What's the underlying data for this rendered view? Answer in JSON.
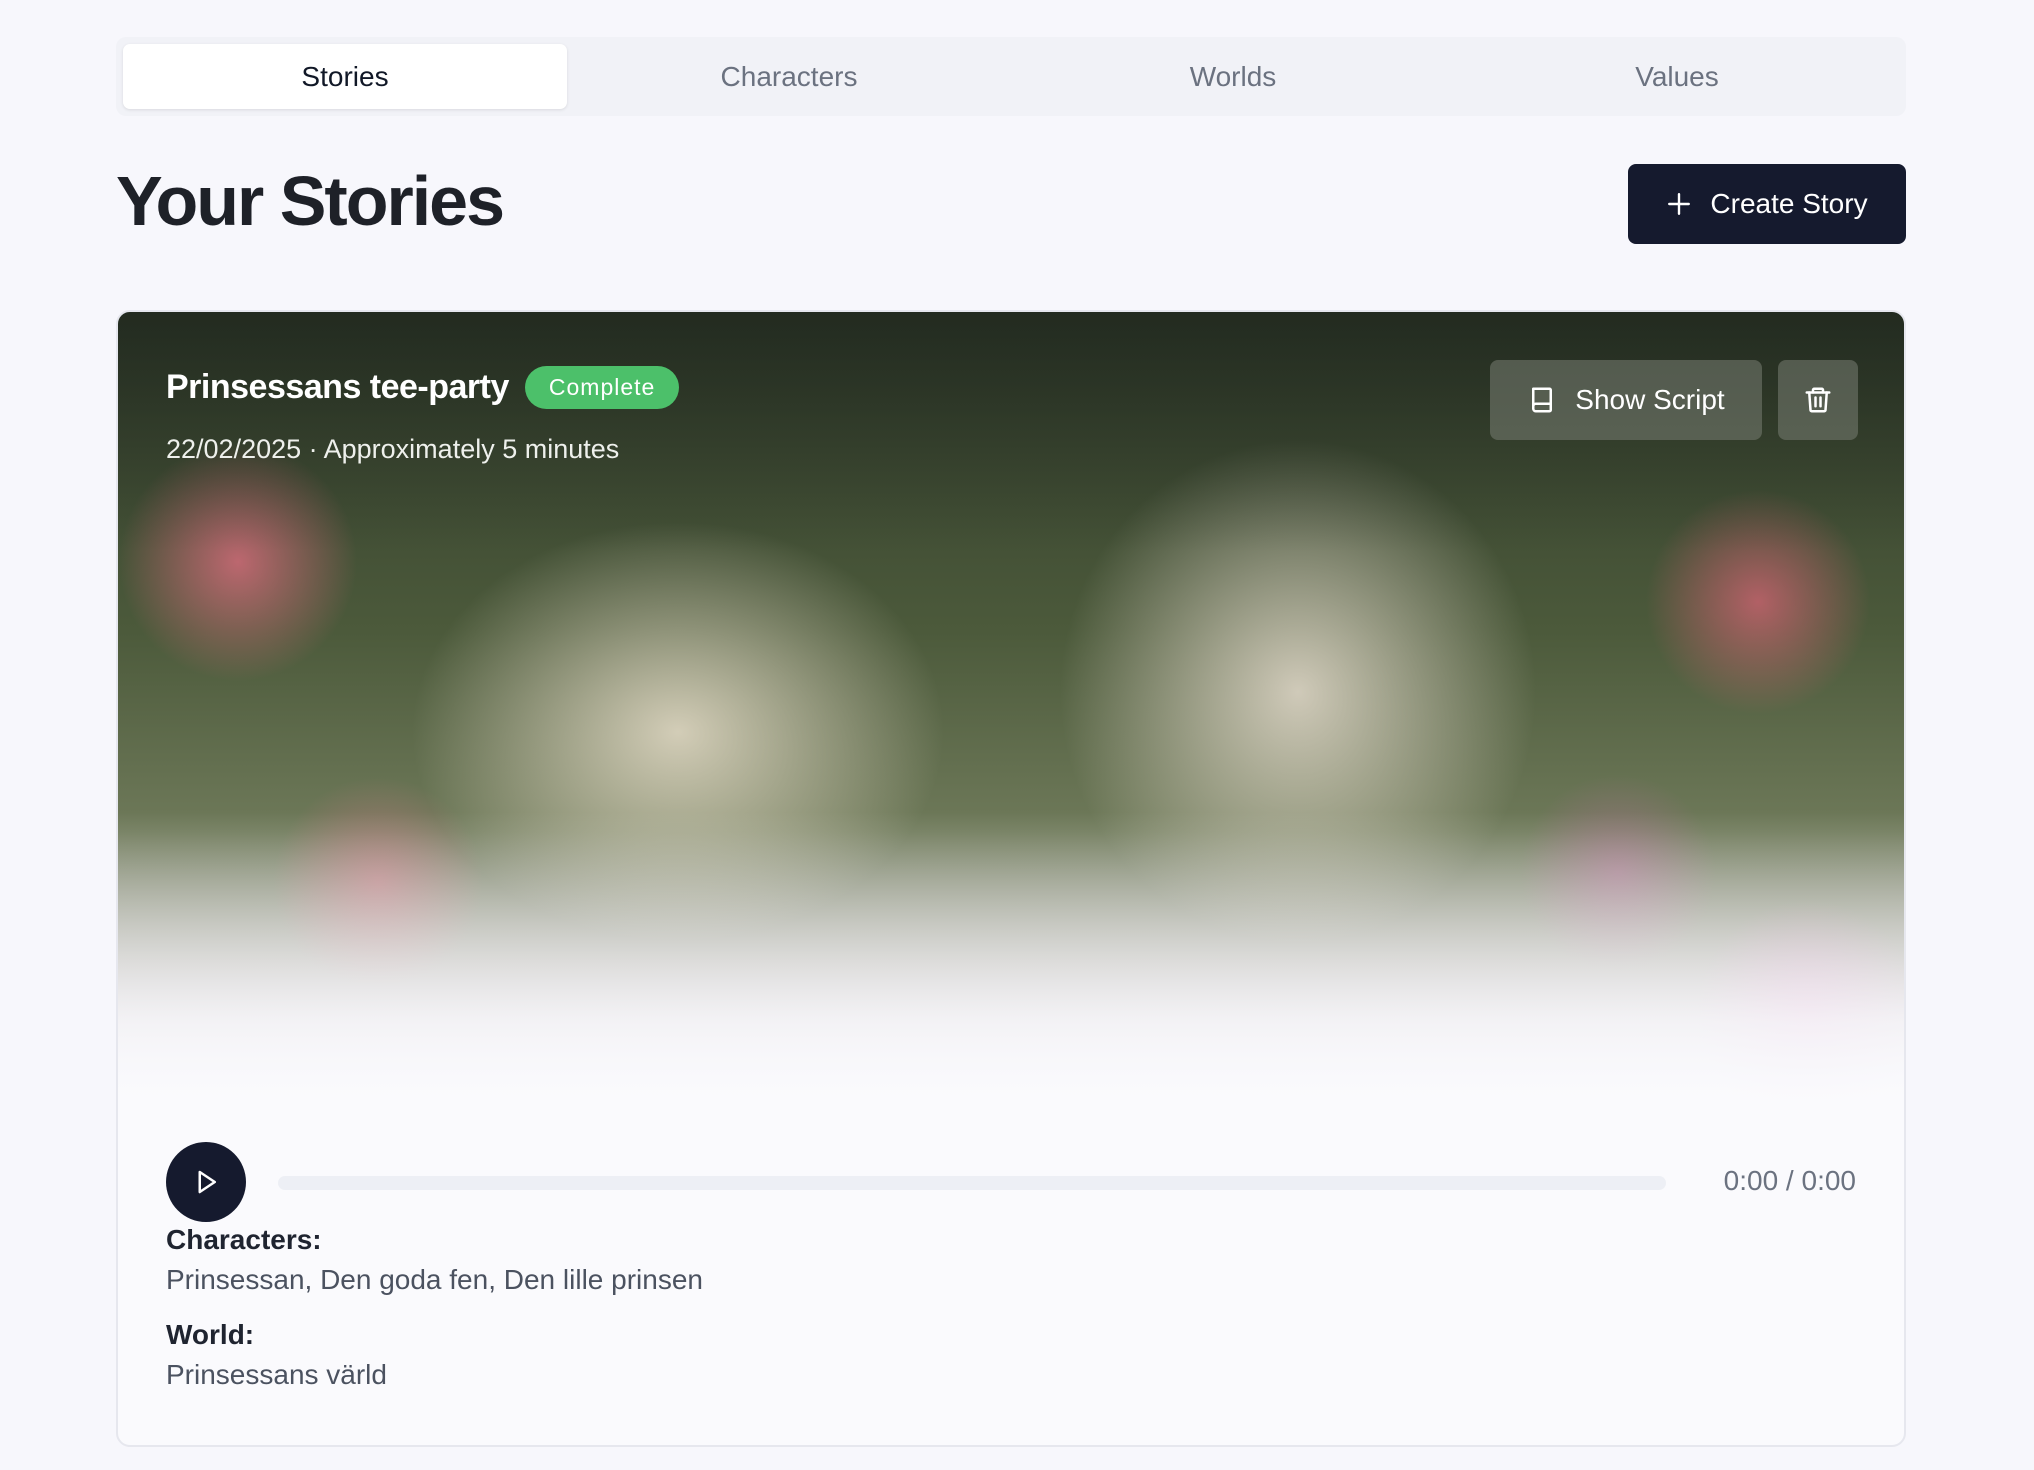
{
  "tabs": [
    {
      "label": "Stories",
      "active": true
    },
    {
      "label": "Characters",
      "active": false
    },
    {
      "label": "Worlds",
      "active": false
    },
    {
      "label": "Values",
      "active": false
    }
  ],
  "header": {
    "title": "Your Stories",
    "create_button_label": "Create Story",
    "create_button_icon": "plus-icon"
  },
  "story": {
    "title": "Prinsessans tee-party",
    "status": "Complete",
    "status_color": "#4cc06a",
    "meta": "22/02/2025 · Approximately 5 minutes",
    "show_script_label": "Show Script",
    "show_script_icon": "book-icon",
    "delete_icon": "trash-icon",
    "player": {
      "play_icon": "play-icon",
      "progress": 0,
      "time": "0:00 / 0:00"
    },
    "characters_label": "Characters:",
    "characters_value": "Prinsessan, Den goda fen, Den lille prinsen",
    "world_label": "World:",
    "world_value": "Prinsessans värld"
  },
  "colors": {
    "accent": "#151a2e",
    "background": "#f7f7fc",
    "muted_text": "#6b7280"
  }
}
